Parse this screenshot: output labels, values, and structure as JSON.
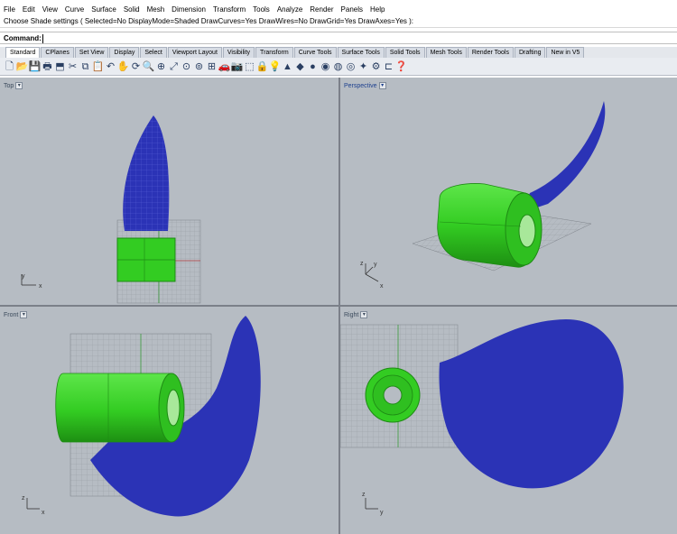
{
  "menubar": [
    "File",
    "Edit",
    "View",
    "Curve",
    "Surface",
    "Solid",
    "Mesh",
    "Dimension",
    "Transform",
    "Tools",
    "Analyze",
    "Render",
    "Panels",
    "Help"
  ],
  "history": "Choose Shade settings ( Selected=No  DisplayMode=Shaded  DrawCurves=Yes  DrawWires=No  DrawGrid=Yes  DrawAxes=Yes ):",
  "command": {
    "label": "Command:",
    "value": ""
  },
  "tabs": [
    "Standard",
    "CPlanes",
    "Set View",
    "Display",
    "Select",
    "Viewport Layout",
    "Visibility",
    "Transform",
    "Curve Tools",
    "Surface Tools",
    "Solid Tools",
    "Mesh Tools",
    "Render Tools",
    "Drafting",
    "New in V5"
  ],
  "active_tab": "Standard",
  "toolbar_icons": [
    {
      "name": "new-icon",
      "glyph": "🗋"
    },
    {
      "name": "open-icon",
      "glyph": "📂"
    },
    {
      "name": "save-icon",
      "glyph": "💾"
    },
    {
      "name": "print-icon",
      "glyph": "🖶"
    },
    {
      "name": "import-icon",
      "glyph": "⬒"
    },
    {
      "name": "cut-icon",
      "glyph": "✂"
    },
    {
      "name": "copy-icon",
      "glyph": "⧉"
    },
    {
      "name": "paste-icon",
      "glyph": "📋"
    },
    {
      "name": "undo-icon",
      "glyph": "↶"
    },
    {
      "name": "pan-icon",
      "glyph": "✋"
    },
    {
      "name": "rotate-view-icon",
      "glyph": "⟳"
    },
    {
      "name": "zoom-icon",
      "glyph": "🔍"
    },
    {
      "name": "zoom-window-icon",
      "glyph": "⊕"
    },
    {
      "name": "zoom-extents-icon",
      "glyph": "⤢"
    },
    {
      "name": "zoom-selected-icon",
      "glyph": "⊙"
    },
    {
      "name": "zoom-all-icon",
      "glyph": "⊚"
    },
    {
      "name": "four-viewports-icon",
      "glyph": "⊞"
    },
    {
      "name": "car-icon",
      "glyph": "🚗"
    },
    {
      "name": "camera-icon",
      "glyph": "📷"
    },
    {
      "name": "select-icon",
      "glyph": "⬚"
    },
    {
      "name": "lock-icon",
      "glyph": "🔒"
    },
    {
      "name": "light-icon",
      "glyph": "💡"
    },
    {
      "name": "layer-icon",
      "glyph": "▲"
    },
    {
      "name": "material-icon",
      "glyph": "◆"
    },
    {
      "name": "shaded-icon",
      "glyph": "●"
    },
    {
      "name": "render-sphere-icon",
      "glyph": "◉"
    },
    {
      "name": "ghost-icon",
      "glyph": "◍"
    },
    {
      "name": "xray-icon",
      "glyph": "◎"
    },
    {
      "name": "grid-snap-icon",
      "glyph": "✦"
    },
    {
      "name": "settings-icon",
      "glyph": "⚙"
    },
    {
      "name": "cplane-icon",
      "glyph": "⊏"
    },
    {
      "name": "help-icon",
      "glyph": "❓"
    }
  ],
  "viewports": [
    {
      "id": "top",
      "label": "Top",
      "active": false,
      "axis1": "y",
      "axis2": "x"
    },
    {
      "id": "perspective",
      "label": "Perspective",
      "active": true,
      "axis1": "y",
      "axis2": "x",
      "axis3": "z"
    },
    {
      "id": "front",
      "label": "Front",
      "active": false,
      "axis1": "z",
      "axis2": "x"
    },
    {
      "id": "right",
      "label": "Right",
      "active": false,
      "axis1": "z",
      "axis2": "y"
    }
  ],
  "colors": {
    "viewport_bg": "#b6bcc3",
    "blade_blue": "#2b33b6",
    "hub_green": "#33cc22",
    "grid": "#8f949b",
    "active_label": "#1c3f8e"
  }
}
